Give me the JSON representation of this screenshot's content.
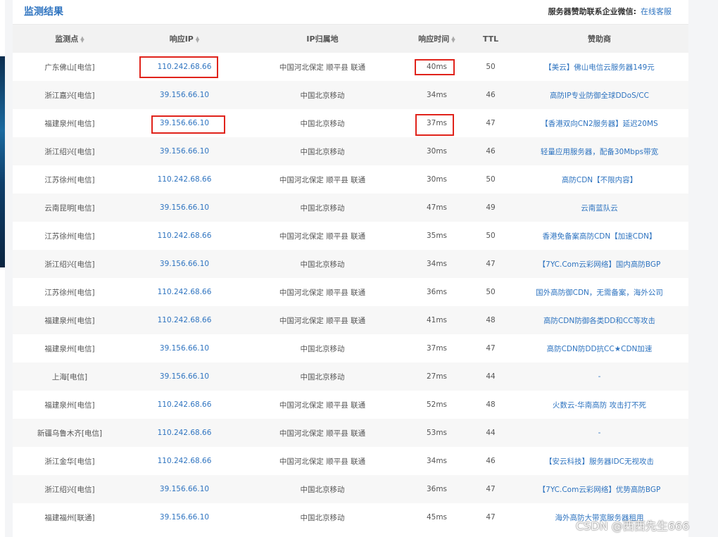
{
  "panel": {
    "title": "监测结果",
    "sponsor_label": "服务器赞助联系企业微信:",
    "sponsor_link": "在线客服"
  },
  "columns": {
    "location": "监测点",
    "ip": "响应IP",
    "ip_location": "IP归属地",
    "response_time": "响应时间",
    "ttl": "TTL",
    "sponsor": "赞助商"
  },
  "rows": [
    {
      "location": "广东佛山[电信]",
      "ip": "110.242.68.66",
      "ip_location": "中国河北保定 顺平县 联通",
      "time": "40ms",
      "ttl": "50",
      "sponsor": "【美云】佛山电信云服务器149元"
    },
    {
      "location": "浙江嘉兴[电信]",
      "ip": "39.156.66.10",
      "ip_location": "中国北京移动",
      "time": "34ms",
      "ttl": "46",
      "sponsor": "高防IP专业防御全球DDoS/CC"
    },
    {
      "location": "福建泉州[电信]",
      "ip": "39.156.66.10",
      "ip_location": "中国北京移动",
      "time": "37ms",
      "ttl": "47",
      "sponsor": "【香港双向CN2服务器】延迟20MS"
    },
    {
      "location": "浙江绍兴[电信]",
      "ip": "39.156.66.10",
      "ip_location": "中国北京移动",
      "time": "30ms",
      "ttl": "46",
      "sponsor": "轻量应用服务器，配备30Mbps带宽"
    },
    {
      "location": "江苏徐州[电信]",
      "ip": "110.242.68.66",
      "ip_location": "中国河北保定 顺平县 联通",
      "time": "30ms",
      "ttl": "50",
      "sponsor": "高防CDN【不限内容】"
    },
    {
      "location": "云南昆明[电信]",
      "ip": "39.156.66.10",
      "ip_location": "中国北京移动",
      "time": "47ms",
      "ttl": "49",
      "sponsor": "云南蓝队云"
    },
    {
      "location": "江苏徐州[电信]",
      "ip": "110.242.68.66",
      "ip_location": "中国河北保定 顺平县 联通",
      "time": "35ms",
      "ttl": "50",
      "sponsor": "香港免备案高防CDN【加速CDN】"
    },
    {
      "location": "浙江绍兴[电信]",
      "ip": "39.156.66.10",
      "ip_location": "中国北京移动",
      "time": "34ms",
      "ttl": "47",
      "sponsor": "【7YC.Com云彩网络】国内高防BGP"
    },
    {
      "location": "江苏徐州[电信]",
      "ip": "110.242.68.66",
      "ip_location": "中国河北保定 顺平县 联通",
      "time": "36ms",
      "ttl": "50",
      "sponsor": "国外高防御CDN，无需备案，海外公司"
    },
    {
      "location": "福建泉州[电信]",
      "ip": "110.242.68.66",
      "ip_location": "中国河北保定 顺平县 联通",
      "time": "41ms",
      "ttl": "48",
      "sponsor": "高防CDN防御各类DD和CC等攻击"
    },
    {
      "location": "福建泉州[电信]",
      "ip": "39.156.66.10",
      "ip_location": "中国北京移动",
      "time": "37ms",
      "ttl": "47",
      "sponsor": "高防CDN防DD抗CC★CDN加速"
    },
    {
      "location": "上海[电信]",
      "ip": "39.156.66.10",
      "ip_location": "中国北京移动",
      "time": "27ms",
      "ttl": "44",
      "sponsor": "-"
    },
    {
      "location": "福建泉州[电信]",
      "ip": "110.242.68.66",
      "ip_location": "中国河北保定 顺平县 联通",
      "time": "52ms",
      "ttl": "48",
      "sponsor": "火数云-华南高防 攻击打不死"
    },
    {
      "location": "新疆乌鲁木齐[电信]",
      "ip": "110.242.68.66",
      "ip_location": "中国河北保定 顺平县 联通",
      "time": "53ms",
      "ttl": "44",
      "sponsor": "-"
    },
    {
      "location": "浙江金华[电信]",
      "ip": "110.242.68.66",
      "ip_location": "中国河北保定 顺平县 联通",
      "time": "34ms",
      "ttl": "46",
      "sponsor": "【安云科技】服务器IDC无视攻击"
    },
    {
      "location": "浙江绍兴[电信]",
      "ip": "39.156.66.10",
      "ip_location": "中国北京移动",
      "time": "36ms",
      "ttl": "47",
      "sponsor": "【7YC.Com云彩网络】优势高防BGP"
    },
    {
      "location": "福建福州[联通]",
      "ip": "39.156.66.10",
      "ip_location": "中国北京移动",
      "time": "45ms",
      "ttl": "47",
      "sponsor": "海外高防大带宽服务器租用"
    }
  ],
  "watermark": "CSDN @西西先生666",
  "colors": {
    "accent": "#2f74c0",
    "highlight": "#e0231b",
    "header_bg": "#f2f2f2",
    "stripe_bg": "#f7f7f7"
  }
}
